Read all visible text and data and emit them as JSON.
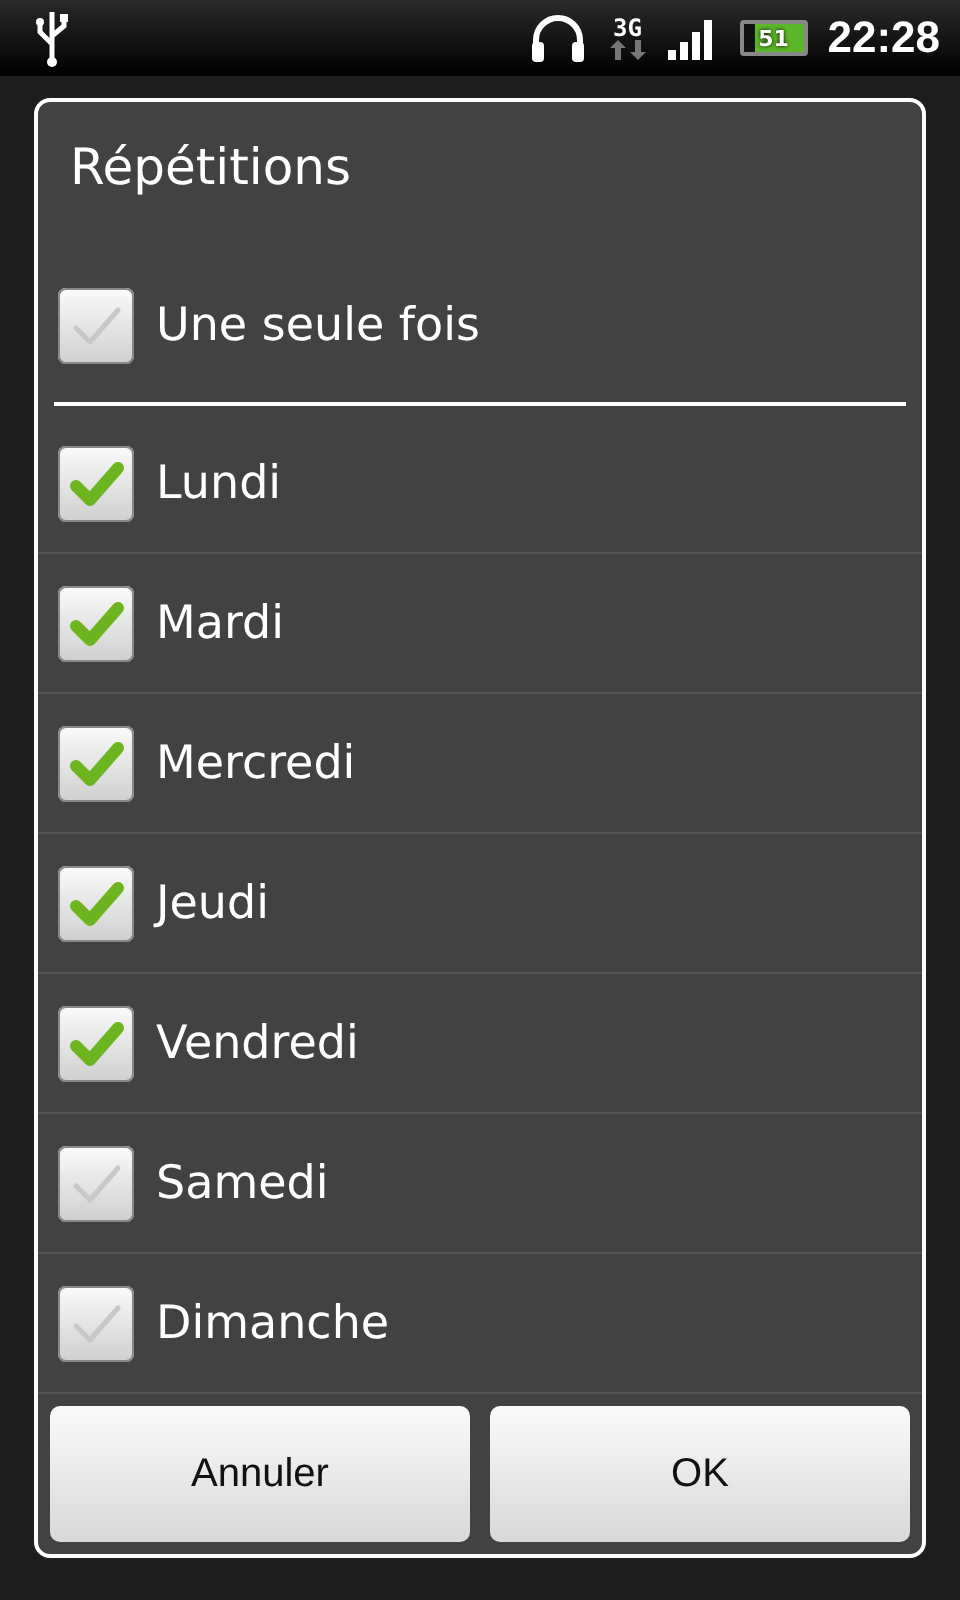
{
  "status_bar": {
    "network": "3G",
    "battery": "51",
    "time": "22:28"
  },
  "dialog": {
    "title": "Répétitions",
    "once": {
      "label": "Une seule fois",
      "checked": false
    },
    "days": [
      {
        "label": "Lundi",
        "checked": true
      },
      {
        "label": "Mardi",
        "checked": true
      },
      {
        "label": "Mercredi",
        "checked": true
      },
      {
        "label": "Jeudi",
        "checked": true
      },
      {
        "label": "Vendredi",
        "checked": true
      },
      {
        "label": "Samedi",
        "checked": false
      },
      {
        "label": "Dimanche",
        "checked": false
      }
    ],
    "buttons": [
      "Annuler",
      "OK"
    ]
  }
}
